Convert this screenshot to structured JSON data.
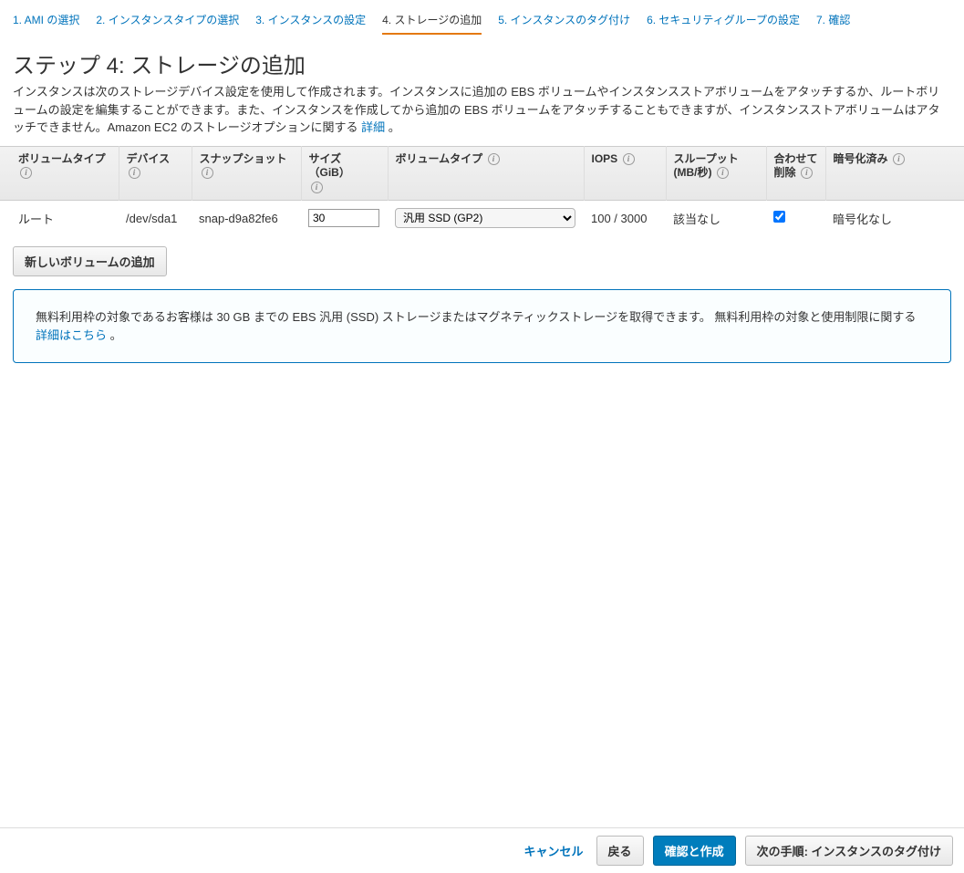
{
  "wizard": {
    "steps": [
      "1. AMI の選択",
      "2. インスタンスタイプの選択",
      "3. インスタンスの設定",
      "4. ストレージの追加",
      "5. インスタンスのタグ付け",
      "6. セキュリティグループの設定",
      "7. 確認"
    ],
    "activeIndex": 3
  },
  "heading": "ステップ 4: ストレージの追加",
  "description": "インスタンスは次のストレージデバイス設定を使用して作成されます。インスタンスに追加の EBS ボリュームやインスタンスストアボリュームをアタッチするか、ルートボリュームの設定を編集することができます。また、インスタンスを作成してから追加の EBS ボリュームをアタッチすることもできますが、インスタンスストアボリュームはアタッチできません。Amazon EC2 のストレージオプションに関する ",
  "descriptionLinkText": "詳細",
  "descriptionAfter": " 。",
  "table": {
    "headers": {
      "volumeType1": "ボリュームタイプ",
      "device": "デバイス",
      "snapshot": "スナップショット",
      "size": "サイズ（GiB）",
      "volumeType2": "ボリュームタイプ",
      "iops": "IOPS",
      "throughput": "スループット (MB/秒)",
      "deleteOnTerm": "合わせて削除",
      "encrypted": "暗号化済み"
    },
    "row": {
      "volumeType1": "ルート",
      "device": "/dev/sda1",
      "snapshot": "snap-d9a82fe6",
      "size": "30",
      "volumeType2": "汎用 SSD (GP2)",
      "iops": "100 / 3000",
      "throughput": "該当なし",
      "deleteOnTerm": true,
      "encrypted": "暗号化なし"
    }
  },
  "addVolumeBtn": "新しいボリュームの追加",
  "notice": {
    "text1": "無料利用枠の対象であるお客様は 30 GB までの EBS 汎用 (SSD) ストレージまたはマグネティックストレージを取得できます。 無料利用枠の対象と使用制限に関する ",
    "link": "詳細はこちら",
    "text2": " 。"
  },
  "footer": {
    "cancel": "キャンセル",
    "back": "戻る",
    "reviewLaunch": "確認と作成",
    "next": "次の手順: インスタンスのタグ付け"
  }
}
